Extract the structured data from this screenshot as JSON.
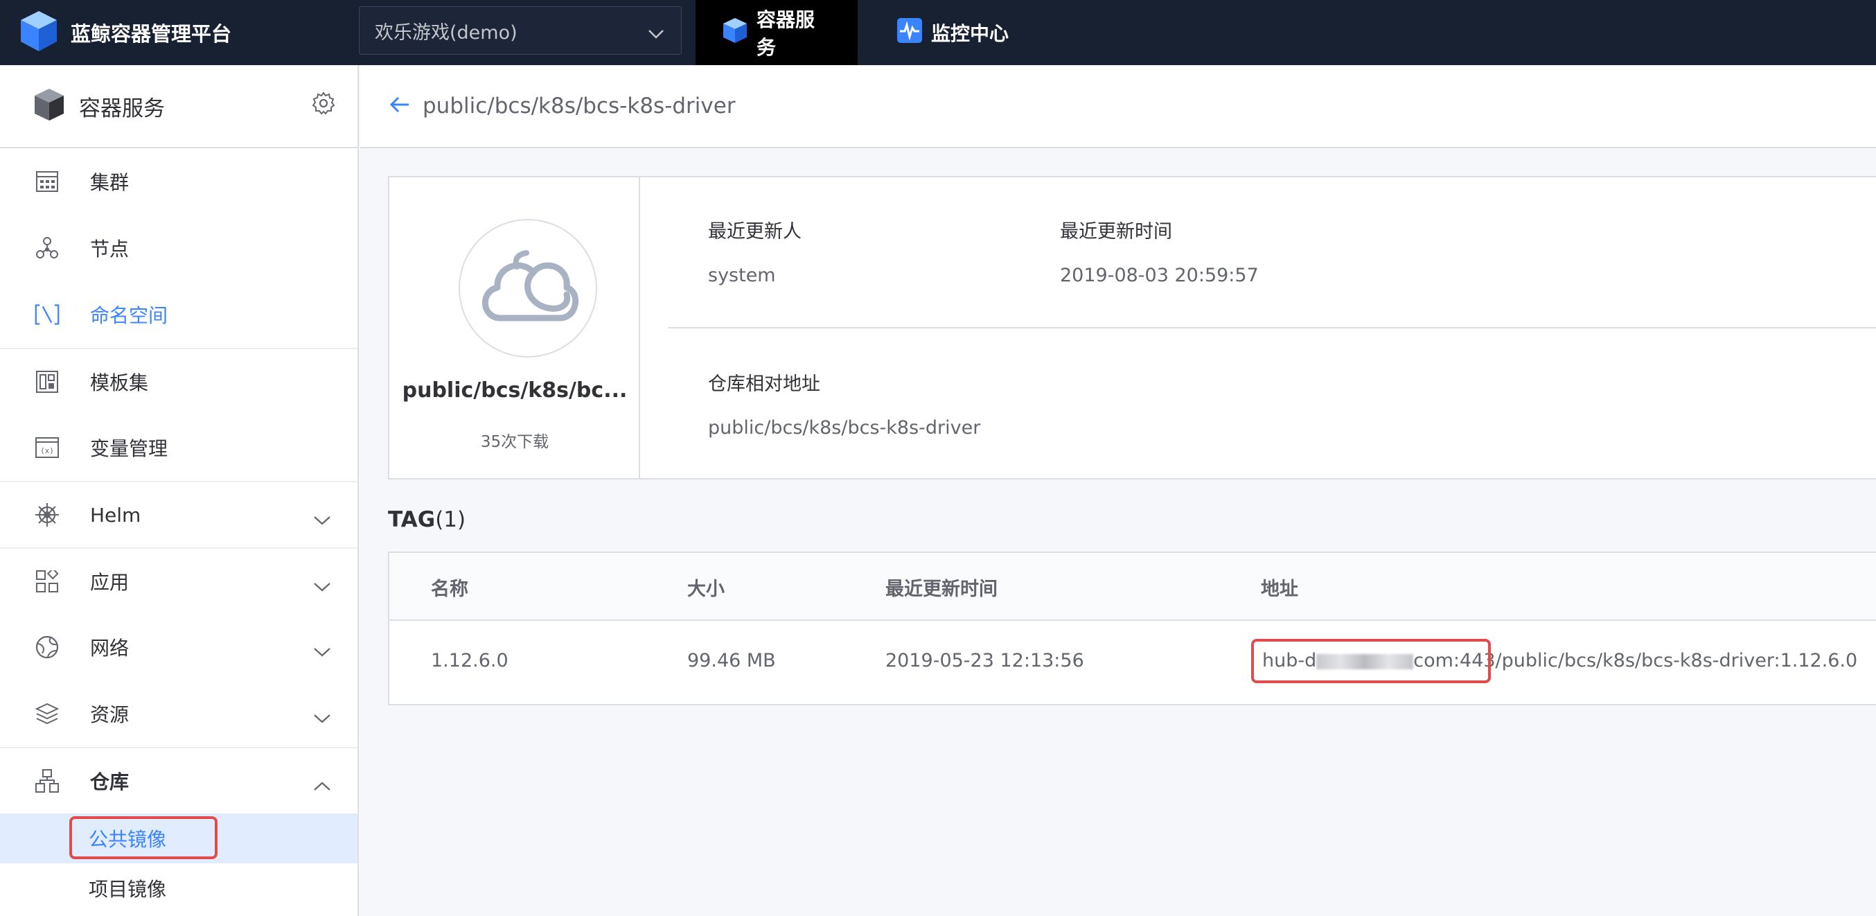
{
  "topbar": {
    "brand_title": "蓝鲸容器管理平台",
    "project_select_value": "欢乐游戏(demo)",
    "tabs": [
      {
        "label": "容器服务",
        "active": true
      },
      {
        "label": "监控中心",
        "active": false
      }
    ]
  },
  "sidebar": {
    "header_title": "容器服务",
    "items": [
      {
        "label": "集群",
        "icon": "cluster-icon"
      },
      {
        "label": "节点",
        "icon": "node-icon"
      },
      {
        "label": "命名空间",
        "icon": "namespace-icon",
        "active": true
      },
      {
        "label": "模板集",
        "icon": "template-icon"
      },
      {
        "label": "变量管理",
        "icon": "variable-icon"
      },
      {
        "label": "Helm",
        "icon": "helm-icon",
        "expandable": true
      },
      {
        "label": "应用",
        "icon": "app-icon",
        "expandable": true
      },
      {
        "label": "网络",
        "icon": "network-icon",
        "expandable": true
      },
      {
        "label": "资源",
        "icon": "resource-icon",
        "expandable": true
      },
      {
        "label": "仓库",
        "icon": "repo-icon",
        "expandable": true,
        "expanded": true
      }
    ],
    "repo_sub_items": [
      {
        "label": "公共镜像",
        "active": true
      },
      {
        "label": "项目镜像",
        "active": false
      }
    ]
  },
  "main": {
    "breadcrumb_path": "public/bcs/k8s/bcs-k8s-driver",
    "image": {
      "name": "public/bcs/k8s/bc...",
      "downloads": "35次下载",
      "updater_label": "最近更新人",
      "updater_value": "system",
      "update_time_label": "最近更新时间",
      "update_time_value": "2019-08-03 20:59:57",
      "repo_path_label": "仓库相对地址",
      "repo_path_value": "public/bcs/k8s/bcs-k8s-driver"
    },
    "tags": {
      "title_bold": "TAG",
      "title_count": "(1)",
      "columns": [
        "名称",
        "大小",
        "最近更新时间",
        "地址"
      ],
      "rows": [
        {
          "name": "1.12.6.0",
          "size": "99.46 MB",
          "updated": "2019-05-23 12:13:56",
          "address_prefix": "hub-d",
          "address_host_suffix": "com:443",
          "address_path": "/public/bcs/k8s/bcs-k8s-driver:1.12.6.0"
        }
      ]
    }
  },
  "colors": {
    "topbar_bg": "#182132",
    "accent": "#3a84ff",
    "highlight_box": "#e04c4c"
  }
}
